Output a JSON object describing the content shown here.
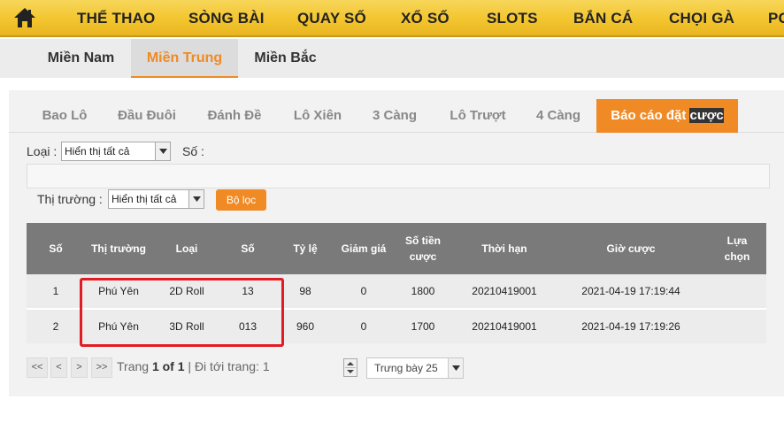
{
  "topnav": {
    "items": [
      "THỂ THAO",
      "SÒNG BÀI",
      "QUAY SỐ",
      "XỔ SỐ",
      "SLOTS",
      "BẮN CÁ",
      "CHỌI GÀ",
      "PO"
    ]
  },
  "regions": {
    "items": [
      "Miền Nam",
      "Miền Trung",
      "Miền Bắc"
    ],
    "active": "Miền Trung"
  },
  "bet_tabs": {
    "items": [
      "Bao Lô",
      "Đầu Đuôi",
      "Đánh Đề",
      "Lô Xiên",
      "3 Càng",
      "Lô Trượt",
      "4 Càng"
    ],
    "report_tab": {
      "prefix": "Báo cáo đặt ",
      "highlight": "cược"
    }
  },
  "filters": {
    "loai_label": "Loại :",
    "loai_value": "Hiển thị tất cả",
    "so_label": "Số :",
    "market_label": "Thị trường :",
    "market_value": "Hiển thị tất cả",
    "filter_button": "Bộ lọc"
  },
  "table": {
    "headers": [
      "Số",
      "Thị trường",
      "Loại",
      "Số",
      "Tỷ lệ",
      "Giảm giá",
      "Số tiền\ncược",
      "Thời hạn",
      "Giờ cược",
      "Lựa\nchọn"
    ],
    "rows": [
      [
        "1",
        "Phú Yên",
        "2D Roll",
        "13",
        "98",
        "0",
        "1800",
        "20210419001",
        "2021-04-19 17:19:44",
        ""
      ],
      [
        "2",
        "Phú Yên",
        "3D Roll",
        "013",
        "960",
        "0",
        "1700",
        "20210419001",
        "2021-04-19 17:19:26",
        ""
      ]
    ]
  },
  "pagination": {
    "first": "<<",
    "prev": "<",
    "next": ">",
    "last": ">>",
    "page_prefix": "Trang ",
    "page_info": "1 of 1",
    "goto_label": " | Đi tới trang: ",
    "goto_value": "1",
    "page_size": "Trưng bày 25"
  },
  "colors": {
    "accent": "#f08a24",
    "nav_bg": "#f3c52e",
    "highlight_box": "#e31b23",
    "table_header": "#7a7a7a"
  }
}
